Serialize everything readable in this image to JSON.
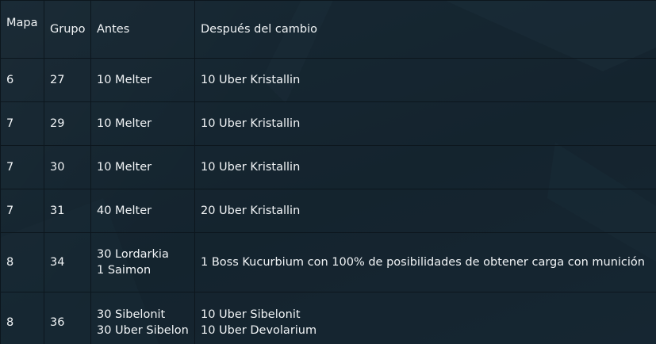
{
  "table": {
    "headers": {
      "mapa": "Mapa",
      "grupo": "Grupo",
      "antes": "Antes",
      "despues": "Después del cambio"
    },
    "rows": [
      {
        "mapa": "6",
        "grupo": "27",
        "antes": [
          "10 Melter"
        ],
        "despues": [
          "10 Uber Kristallin"
        ]
      },
      {
        "mapa": "7",
        "grupo": "29",
        "antes": [
          "10 Melter"
        ],
        "despues": [
          "10 Uber Kristallin"
        ]
      },
      {
        "mapa": "7",
        "grupo": "30",
        "antes": [
          "10 Melter"
        ],
        "despues": [
          "10 Uber Kristallin"
        ]
      },
      {
        "mapa": "7",
        "grupo": "31",
        "antes": [
          "40 Melter"
        ],
        "despues": [
          "20 Uber Kristallin"
        ]
      },
      {
        "mapa": "8",
        "grupo": "34",
        "antes": [
          "30 Lordarkia",
          "1 Saimon"
        ],
        "despues": [
          "1 Boss Kucurbium con 100% de posibilidades de obtener carga con munición"
        ]
      },
      {
        "mapa": "8",
        "grupo": "36",
        "antes": [
          "30 Sibelonit",
          "30 Uber Sibelon"
        ],
        "despues": [
          "10 Uber Sibelonit",
          "10 Uber Devolarium"
        ]
      }
    ]
  }
}
